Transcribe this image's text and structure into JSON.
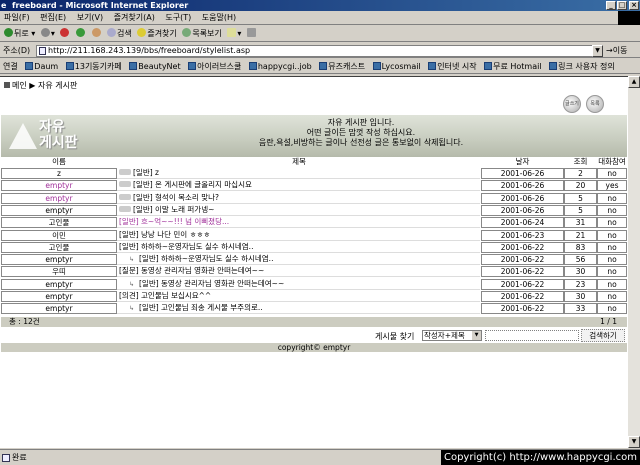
{
  "window": {
    "title": "freeboard - Microsoft Internet Explorer",
    "minimize": "_",
    "maximize": "□",
    "close": "×"
  },
  "menu": [
    "파일(F)",
    "편집(E)",
    "보기(V)",
    "즐겨찾기(A)",
    "도구(T)",
    "도움말(H)"
  ],
  "toolbar": {
    "back": "뒤로",
    "search": "검색",
    "favorites": "즐겨찾기",
    "history": "목록보기"
  },
  "address": {
    "label": "주소(D)",
    "url": "http://211.168.243.139/bbs/freeboard/stylelist.asp",
    "go": "이동"
  },
  "links": {
    "label": "연결",
    "items": [
      "Daum",
      "13기동기카페",
      "BeautyNet",
      "아이러브스쿨",
      "happycgi..job",
      "뮤즈캐스트",
      "Lycosmail",
      "인터넷 시작",
      "무료 Hotmail",
      "링크 사용자 정의"
    ]
  },
  "page": {
    "breadcrumb": "메인 ▶ 자유 게시판",
    "btn_write": "글쓰기",
    "btn_list": "목록",
    "logo": "자유\n게시판",
    "welcome": [
      "자유 게시판 입니다.",
      "어떤 글이든 맘껏 작성 하십시요.",
      "음란,욕설,비방하는 글이나 선전성 글은 통보없이 삭제됩니다."
    ],
    "headers": {
      "name": "이름",
      "title": "제목",
      "date": "날자",
      "hit": "조회",
      "reply": "대화참여"
    },
    "rows": [
      {
        "name": "z",
        "title": "[일반] z",
        "date": "2001-06-26",
        "hit": "2",
        "reply": "no",
        "pink_name": false,
        "pink_title": false,
        "indent": false,
        "icon": true
      },
      {
        "name": "emptyr",
        "title": "[일반] 온 게시판에 글올리지 마십시요",
        "date": "2001-06-26",
        "hit": "20",
        "reply": "yes",
        "pink_name": true,
        "pink_title": false,
        "indent": false,
        "icon": true
      },
      {
        "name": "emptyr",
        "title": "[일반] 형석이 목소리 맞나?",
        "date": "2001-06-26",
        "hit": "5",
        "reply": "no",
        "pink_name": true,
        "pink_title": false,
        "indent": false,
        "icon": true
      },
      {
        "name": "emptyr",
        "title": "[일반] 이말 노래 퍼가넹~",
        "date": "2001-06-26",
        "hit": "5",
        "reply": "no",
        "pink_name": false,
        "pink_title": false,
        "indent": false,
        "icon": true
      },
      {
        "name": "고인물",
        "title": "[일반] 흐~억~~!!! 넘 이삐졌당...",
        "date": "2001-06-24",
        "hit": "31",
        "reply": "no",
        "pink_name": false,
        "pink_title": true,
        "indent": false,
        "icon": false
      },
      {
        "name": "이민",
        "title": "[일반] 낭낭 나단 민이 ㅎㅎㅎ",
        "date": "2001-06-23",
        "hit": "21",
        "reply": "no",
        "pink_name": false,
        "pink_title": false,
        "indent": false,
        "icon": false
      },
      {
        "name": "고인물",
        "title": "[일반] 하하하~운영자님도 실수 하시네염..",
        "date": "2001-06-22",
        "hit": "83",
        "reply": "no",
        "pink_name": false,
        "pink_title": false,
        "indent": false,
        "icon": false
      },
      {
        "name": "emptyr",
        "title": "[일반] 하하하~운영자님도 실수 하시네염..",
        "date": "2001-06-22",
        "hit": "56",
        "reply": "no",
        "pink_name": false,
        "pink_title": false,
        "indent": true,
        "icon": false
      },
      {
        "name": "우띠",
        "title": "[질문] 동영상 관리자님 영화관 안떠는데여~~",
        "date": "2001-06-22",
        "hit": "30",
        "reply": "no",
        "pink_name": false,
        "pink_title": false,
        "indent": false,
        "icon": false
      },
      {
        "name": "emptyr",
        "title": "[일반] 동영상 관리자님 영화관 안떠는데여~~",
        "date": "2001-06-22",
        "hit": "23",
        "reply": "no",
        "pink_name": false,
        "pink_title": false,
        "indent": true,
        "icon": false
      },
      {
        "name": "emptyr",
        "title": "[의견] 고인물님 보십시요^^",
        "date": "2001-06-22",
        "hit": "30",
        "reply": "no",
        "pink_name": false,
        "pink_title": false,
        "indent": false,
        "icon": false
      },
      {
        "name": "emptyr",
        "title": "[일반] 고인물님 죄송 게시물 부주의로..",
        "date": "2001-06-22",
        "hit": "33",
        "reply": "no",
        "pink_name": false,
        "pink_title": false,
        "indent": true,
        "icon": false
      }
    ],
    "total": "총 : 12건",
    "pager": "1 / 1",
    "search_label": "게시물 찾기",
    "search_option": "작성자+제목",
    "search_button": "검색하기",
    "copyright": "copyright© emptyr"
  },
  "status": {
    "text": "완료",
    "watermark": "Copyright(c) http://www.happycgi.com"
  }
}
